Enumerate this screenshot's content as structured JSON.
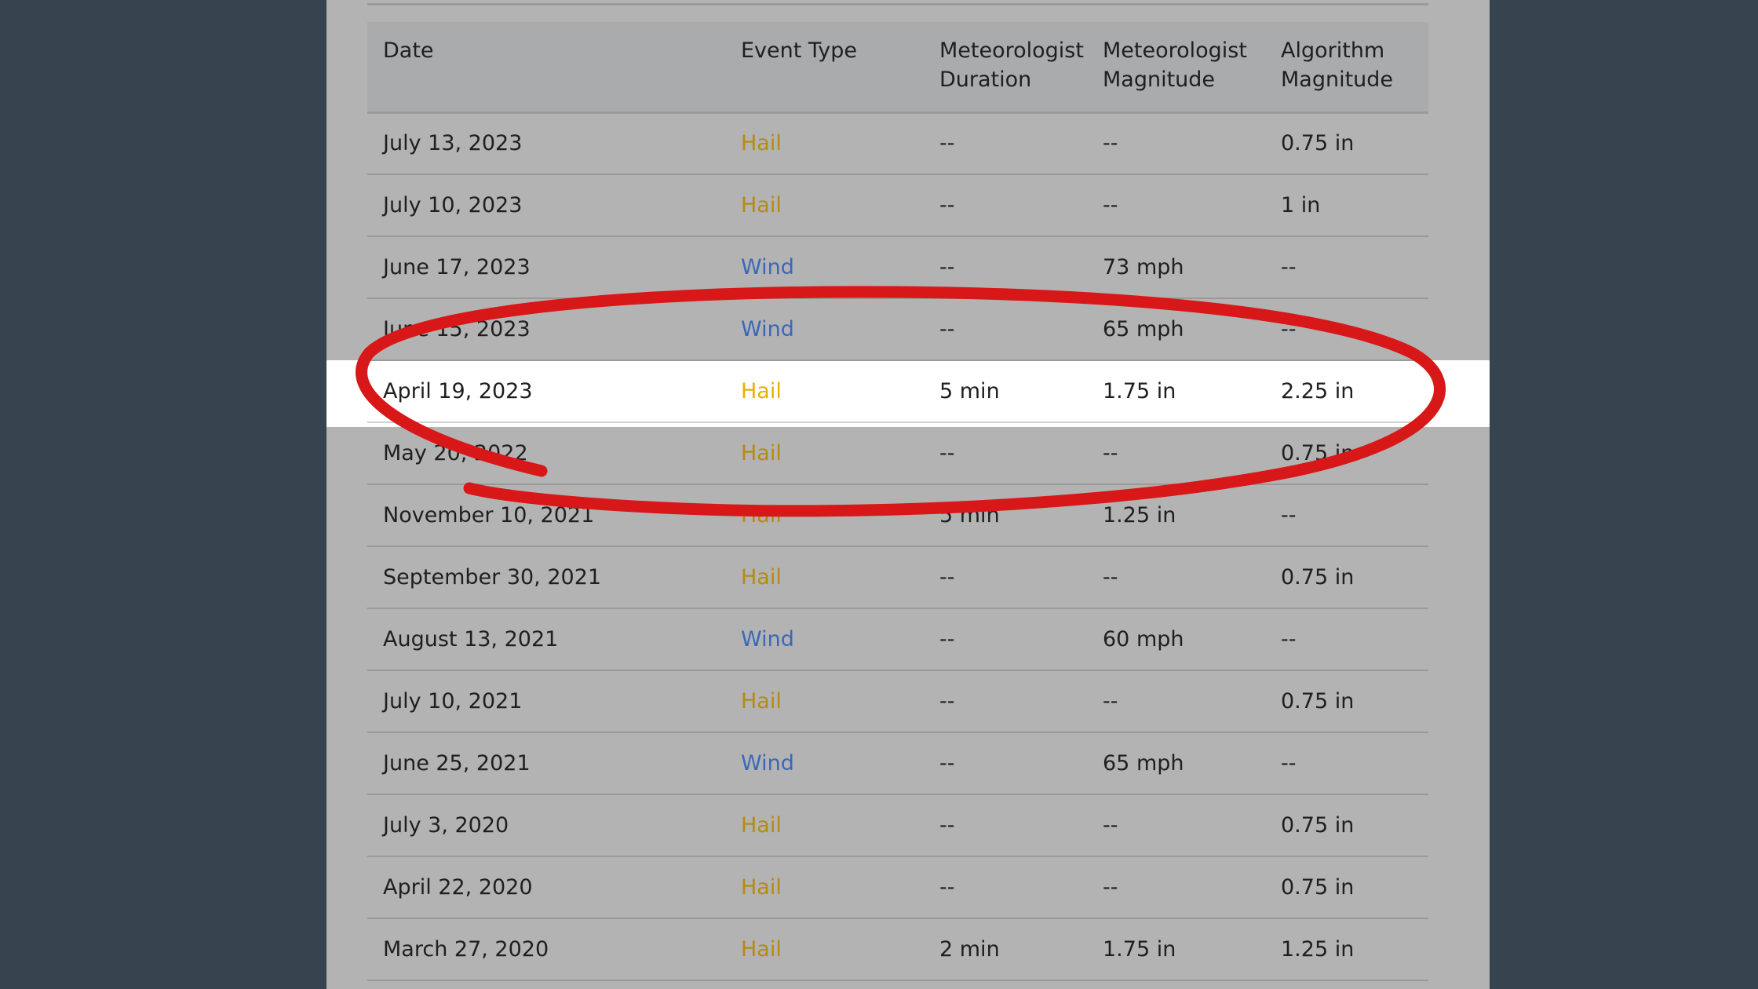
{
  "table": {
    "headers": {
      "date": "Date",
      "event_type": "Event Type",
      "met_duration_l1": "Meteorologist",
      "met_duration_l2": "Duration",
      "met_magnitude_l1": "Meteorologist",
      "met_magnitude_l2": "Magnitude",
      "alg_magnitude_l1": "Algorithm",
      "alg_magnitude_l2": "Magnitude"
    },
    "rows": [
      {
        "date": "July 13, 2023",
        "type": "Hail",
        "met_duration": "--",
        "met_magnitude": "--",
        "alg_magnitude": "0.75 in"
      },
      {
        "date": "July 10, 2023",
        "type": "Hail",
        "met_duration": "--",
        "met_magnitude": "--",
        "alg_magnitude": "1 in"
      },
      {
        "date": "June 17, 2023",
        "type": "Wind",
        "met_duration": "--",
        "met_magnitude": "73 mph",
        "alg_magnitude": "--"
      },
      {
        "date": "June 15, 2023",
        "type": "Wind",
        "met_duration": "--",
        "met_magnitude": "65 mph",
        "alg_magnitude": "--"
      },
      {
        "date": "April 19, 2023",
        "type": "Hail",
        "met_duration": "5 min",
        "met_magnitude": "1.75 in",
        "alg_magnitude": "2.25 in"
      },
      {
        "date": "May 20, 2022",
        "type": "Hail",
        "met_duration": "--",
        "met_magnitude": "--",
        "alg_magnitude": "0.75 in"
      },
      {
        "date": "November 10, 2021",
        "type": "Hail",
        "met_duration": "5 min",
        "met_magnitude": "1.25 in",
        "alg_magnitude": "--"
      },
      {
        "date": "September 30, 2021",
        "type": "Hail",
        "met_duration": "--",
        "met_magnitude": "--",
        "alg_magnitude": "0.75 in"
      },
      {
        "date": "August 13, 2021",
        "type": "Wind",
        "met_duration": "--",
        "met_magnitude": "60 mph",
        "alg_magnitude": "--"
      },
      {
        "date": "July 10, 2021",
        "type": "Hail",
        "met_duration": "--",
        "met_magnitude": "--",
        "alg_magnitude": "0.75 in"
      },
      {
        "date": "June 25, 2021",
        "type": "Wind",
        "met_duration": "--",
        "met_magnitude": "65 mph",
        "alg_magnitude": "--"
      },
      {
        "date": "July 3, 2020",
        "type": "Hail",
        "met_duration": "--",
        "met_magnitude": "--",
        "alg_magnitude": "0.75 in"
      },
      {
        "date": "April 22, 2020",
        "type": "Hail",
        "met_duration": "--",
        "met_magnitude": "--",
        "alg_magnitude": "0.75 in"
      },
      {
        "date": "March 27, 2020",
        "type": "Hail",
        "met_duration": "2 min",
        "met_magnitude": "1.75 in",
        "alg_magnitude": "1.25 in"
      }
    ]
  },
  "highlighted_row": 4,
  "colors": {
    "background": "#37444f",
    "panel": "#b3b3b3",
    "highlight": "#ffffff",
    "hail": "#b78a10",
    "hail_highlighted": "#e8b000",
    "wind": "#3a68b8",
    "annotation": "#d81818"
  }
}
